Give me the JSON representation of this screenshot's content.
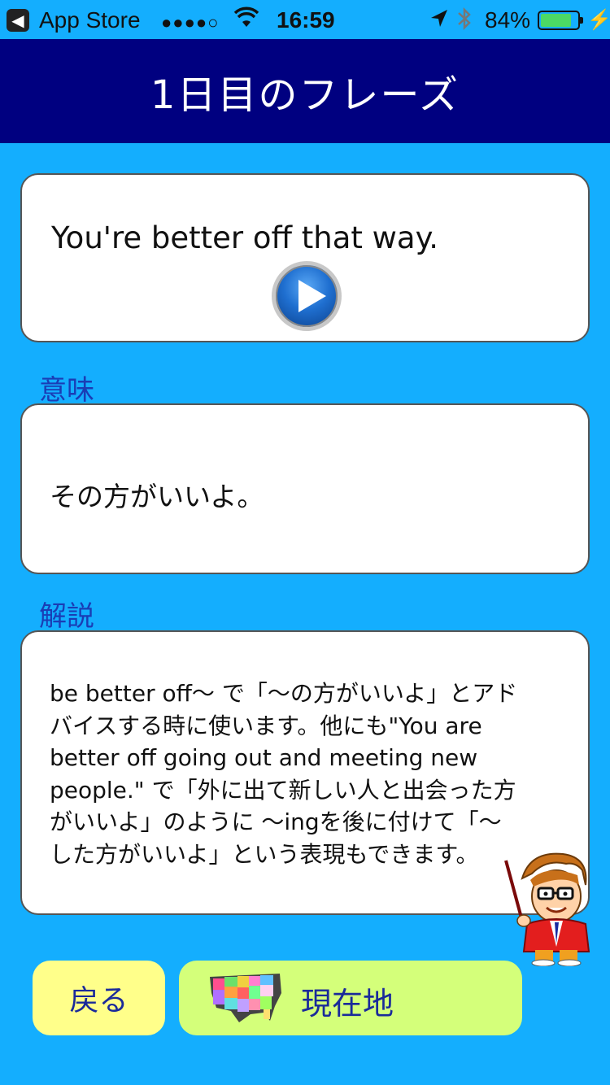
{
  "status_bar": {
    "back_glyph": "◀",
    "carrier": "App Store",
    "signal": "●●●●○",
    "time": "16:59",
    "battery_percent": "84%",
    "battery_level": 0.84
  },
  "nav": {
    "title": "1日目のフレーズ"
  },
  "phrase": {
    "text": "You're better off that way."
  },
  "meaning": {
    "label": "意味",
    "text": "その方がいいよ。"
  },
  "explanation": {
    "label": "解説",
    "text": "be better off〜 で「〜の方がいいよ」とアド\nバイスする時に使います。他にも\"You are\nbetter off going out and meeting new\npeople.\" で「外に出て新しい人と出会った方\nがいいよ」のように 〜ingを後に付けて「〜\nした方がいいよ」という表現もできます。"
  },
  "buttons": {
    "back_label": "戻る",
    "location_label": "現在地"
  },
  "colors": {
    "background": "#14AEFE",
    "nav_bar": "#000080",
    "back_button": "#FFFF8A",
    "location_button": "#D4FF7A",
    "label_text": "#1a3db5"
  },
  "icons": {
    "play": "play-icon",
    "usa_map": "usa-map-icon",
    "mascot": "teacher-mascot"
  }
}
